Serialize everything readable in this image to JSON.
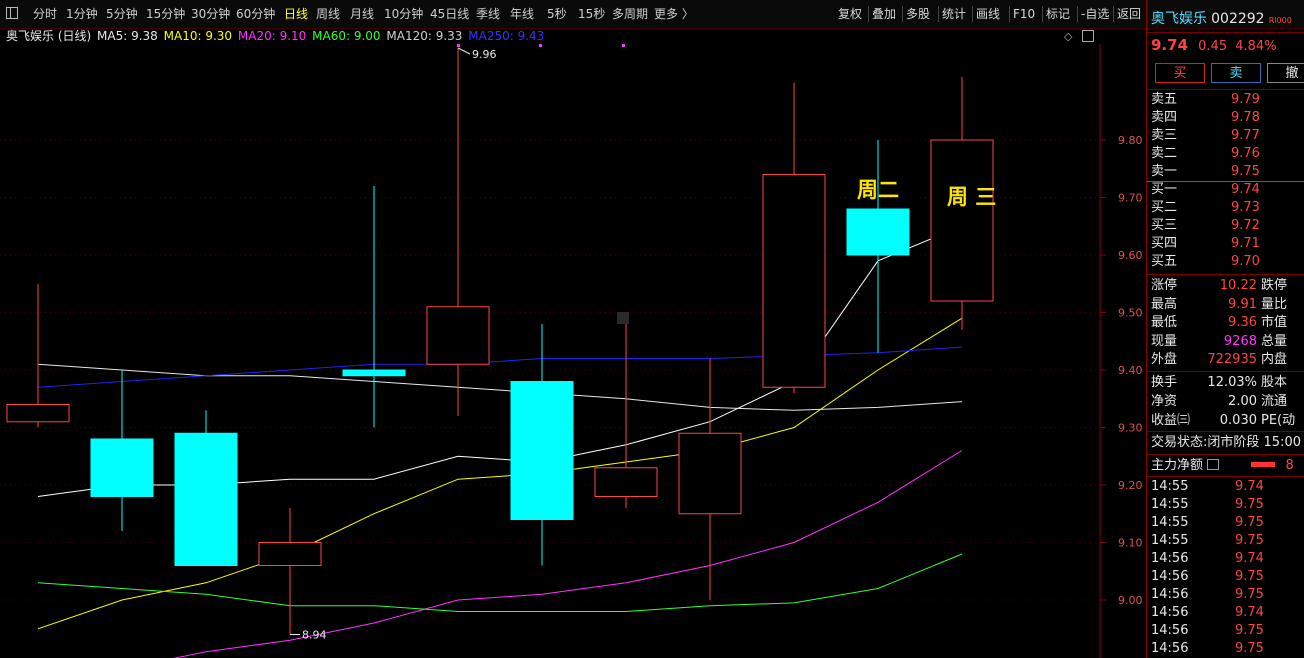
{
  "toolbar": {
    "periods": [
      "分时",
      "1分钟",
      "5分钟",
      "15分钟",
      "30分钟",
      "60分钟",
      "日线",
      "周线",
      "月线",
      "10分钟",
      "45日线",
      "季线",
      "年线",
      "5秒",
      "15秒",
      "多周期",
      "更多 〉"
    ],
    "active_period": "日线",
    "right_buttons": [
      "复权",
      "叠加",
      "多股",
      "统计",
      "画线",
      "F10",
      "标记",
      "-自选",
      "返回"
    ]
  },
  "legend": {
    "title": "奥飞娱乐 (日线)",
    "ma5": "MA5: 9.38",
    "ma10": "MA10: 9.30",
    "ma20": "MA20: 9.10",
    "ma60": "MA60: 9.00",
    "ma120": "MA120: 9.33",
    "ma250": "MA250: 9.43"
  },
  "chart_data": {
    "type": "candlestick",
    "y_ticks": [
      9.0,
      9.1,
      9.2,
      9.3,
      9.4,
      9.5,
      9.6,
      9.7,
      9.8
    ],
    "ylim": [
      8.92,
      10.03
    ],
    "candles": [
      {
        "open": 9.31,
        "close": 9.34,
        "high": 9.55,
        "low": 9.3,
        "dir": "up"
      },
      {
        "open": 9.28,
        "close": 9.18,
        "high": 9.4,
        "low": 9.12,
        "dir": "down"
      },
      {
        "open": 9.29,
        "close": 9.06,
        "high": 9.33,
        "low": 9.06,
        "dir": "down"
      },
      {
        "open": 9.06,
        "close": 9.1,
        "high": 9.16,
        "low": 8.94,
        "dir": "up"
      },
      {
        "open": 9.4,
        "close": 9.39,
        "high": 9.72,
        "low": 9.3,
        "dir": "down"
      },
      {
        "open": 9.41,
        "close": 9.51,
        "high": 9.96,
        "low": 9.32,
        "dir": "up"
      },
      {
        "open": 9.38,
        "close": 9.14,
        "high": 9.48,
        "low": 9.06,
        "dir": "down"
      },
      {
        "open": 9.18,
        "close": 9.23,
        "high": 9.48,
        "low": 9.16,
        "dir": "up"
      },
      {
        "open": 9.15,
        "close": 9.29,
        "high": 9.42,
        "low": 9.0,
        "dir": "up"
      },
      {
        "open": 9.37,
        "close": 9.74,
        "high": 9.9,
        "low": 9.36,
        "dir": "up"
      },
      {
        "open": 9.68,
        "close": 9.6,
        "high": 9.8,
        "low": 9.43,
        "dir": "down"
      },
      {
        "open": 9.52,
        "close": 9.8,
        "high": 9.91,
        "low": 9.47,
        "dir": "up"
      }
    ],
    "ma_series": [
      {
        "name": "MA5",
        "color": "#ffffff",
        "values": [
          9.18,
          9.2,
          9.2,
          9.21,
          9.21,
          9.25,
          9.24,
          9.27,
          9.31,
          9.38,
          9.59,
          9.65
        ]
      },
      {
        "name": "MA10",
        "color": "#ffff00",
        "values": [
          8.95,
          9.0,
          9.03,
          9.08,
          9.15,
          9.21,
          9.22,
          9.24,
          9.26,
          9.3,
          9.4,
          9.49
        ]
      },
      {
        "name": "MA20",
        "color": "#ff33ff",
        "values": [
          8.85,
          8.88,
          8.91,
          8.93,
          8.96,
          9.0,
          9.01,
          9.03,
          9.06,
          9.1,
          9.17,
          9.26
        ]
      },
      {
        "name": "MA60",
        "color": "#33ff33",
        "values": [
          9.03,
          9.02,
          9.01,
          8.99,
          8.99,
          8.98,
          8.98,
          8.98,
          8.99,
          8.995,
          9.02,
          9.08
        ]
      },
      {
        "name": "MA120",
        "color": "#e8e8e8",
        "values": [
          9.41,
          9.4,
          9.39,
          9.39,
          9.38,
          9.37,
          9.36,
          9.35,
          9.335,
          9.33,
          9.335,
          9.345
        ]
      },
      {
        "name": "MA250",
        "color": "#2222ee",
        "values": [
          9.37,
          9.38,
          9.39,
          9.4,
          9.41,
          9.41,
          9.42,
          9.42,
          9.42,
          9.425,
          9.43,
          9.44
        ]
      }
    ],
    "high_label": "9.96",
    "low_label": "8.94",
    "annotations": [
      "周二",
      "周 三"
    ]
  },
  "panel": {
    "name": "奥飞娱乐",
    "code": "002292",
    "badge": "Rl000",
    "price": "9.74",
    "change": "0.45",
    "change_pct": "4.84%",
    "buttons": [
      "买",
      "卖",
      "撤"
    ],
    "asks": [
      {
        "label": "卖五",
        "price": "9.79"
      },
      {
        "label": "卖四",
        "price": "9.78"
      },
      {
        "label": "卖三",
        "price": "9.77"
      },
      {
        "label": "卖二",
        "price": "9.76"
      },
      {
        "label": "卖一",
        "price": "9.75"
      }
    ],
    "bids": [
      {
        "label": "买一",
        "price": "9.74"
      },
      {
        "label": "买二",
        "price": "9.73"
      },
      {
        "label": "买三",
        "price": "9.72"
      },
      {
        "label": "买四",
        "price": "9.71"
      },
      {
        "label": "买五",
        "price": "9.70"
      }
    ],
    "stats1": [
      {
        "label": "涨停",
        "value": "10.22",
        "label2": "跌停",
        "color": "red"
      },
      {
        "label": "最高",
        "value": "9.91",
        "label2": "量比",
        "color": "red"
      },
      {
        "label": "最低",
        "value": "9.36",
        "label2": "市值",
        "color": "red"
      },
      {
        "label": "现量",
        "value": "9268",
        "label2": "总量",
        "color": "mag"
      },
      {
        "label": "外盘",
        "value": "722935",
        "label2": "内盘",
        "color": "red"
      }
    ],
    "stats2": [
      {
        "label": "换手",
        "value": "12.03%",
        "label2": "股本"
      },
      {
        "label": "净资",
        "value": "2.00",
        "label2": "流通"
      },
      {
        "label": "收益㈢",
        "value": "0.030",
        "label2": "PE(动"
      }
    ],
    "trade_status_label": "交易状态:",
    "trade_status_value": "闭市阶段 15:00",
    "capital_label": "主力净额",
    "capital_value": "8",
    "ticks": [
      {
        "time": "14:55",
        "price": "9.74"
      },
      {
        "time": "14:55",
        "price": "9.75"
      },
      {
        "time": "14:55",
        "price": "9.75"
      },
      {
        "time": "14:55",
        "price": "9.75"
      },
      {
        "time": "14:56",
        "price": "9.74"
      },
      {
        "time": "14:56",
        "price": "9.75"
      },
      {
        "time": "14:56",
        "price": "9.75"
      },
      {
        "time": "14:56",
        "price": "9.74"
      },
      {
        "time": "14:56",
        "price": "9.75"
      },
      {
        "time": "14:56",
        "price": "9.75"
      }
    ]
  }
}
